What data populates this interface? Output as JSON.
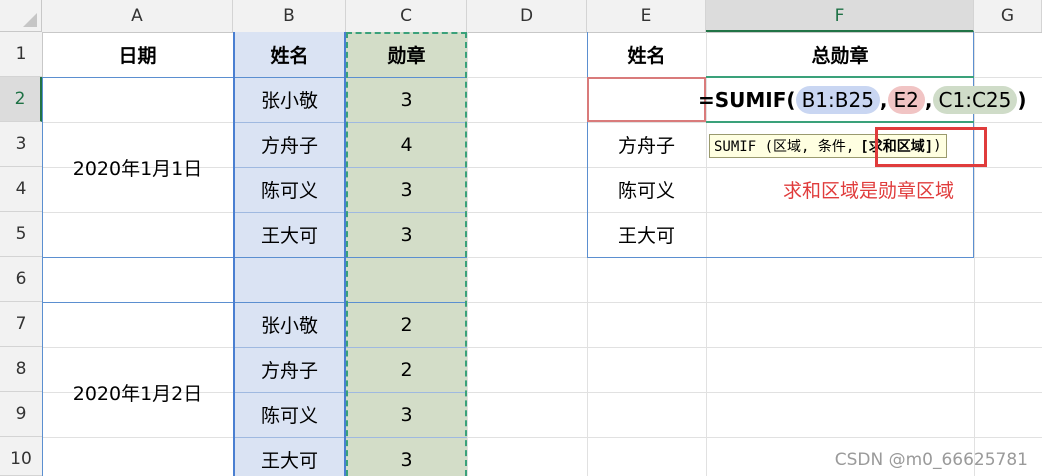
{
  "columns": [
    "A",
    "B",
    "C",
    "D",
    "E",
    "F",
    "G"
  ],
  "active_column": "F",
  "rows": [
    "1",
    "2",
    "3",
    "4",
    "5",
    "6",
    "7",
    "8",
    "9",
    "10"
  ],
  "active_row": "2",
  "headers": {
    "a1": "日期",
    "b1": "姓名",
    "c1": "勋章",
    "e1": "姓名",
    "f1": "总勋章"
  },
  "group1": {
    "date": "2020年1月1日",
    "names": [
      "张小敬",
      "方舟子",
      "陈可义",
      "王大可"
    ],
    "medals": [
      "3",
      "4",
      "3",
      "3"
    ]
  },
  "group2": {
    "date": "2020年1月2日",
    "names": [
      "张小敬",
      "方舟子",
      "陈可义",
      "王大可"
    ],
    "medals": [
      "2",
      "2",
      "3",
      "3"
    ]
  },
  "lookup_names": [
    "方舟子",
    "陈可义",
    "王大可"
  ],
  "formula": {
    "prefix": "=SUMIF(",
    "arg1": "B1:B25",
    "sep1": ",",
    "arg2": "E2",
    "sep2": ",",
    "arg3": "C1:C25",
    "suffix": ")"
  },
  "tooltip": {
    "text": "SUMIF (区域, 条件,",
    "highlight": "[求和区域]",
    "close": ")"
  },
  "annotation": "求和区域是勋章区域",
  "watermark": "CSDN @m0_66625781",
  "colors": {
    "accent_green": "#217346",
    "range_blue": "#4a7fd1",
    "range_green": "#3aa17a",
    "highlight_red": "#e03c3c"
  }
}
